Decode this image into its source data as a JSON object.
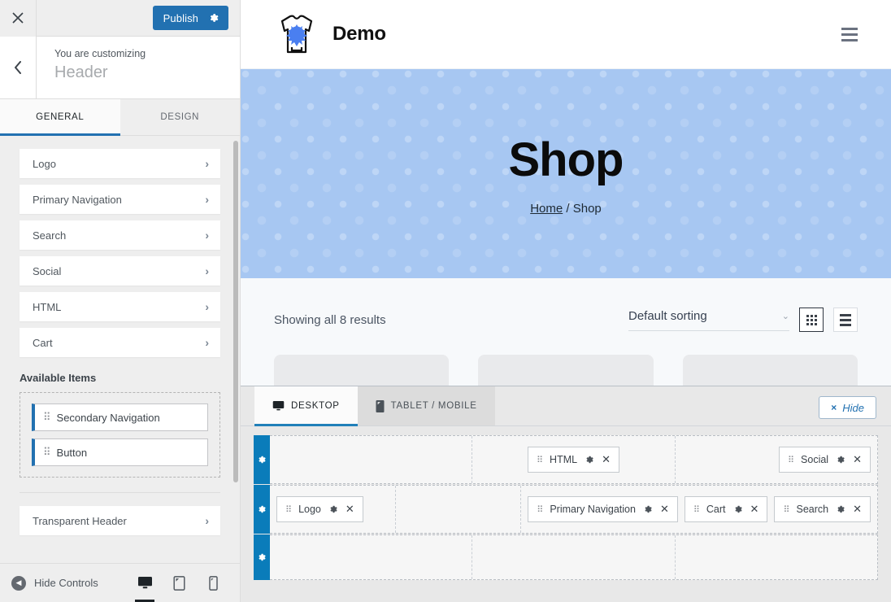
{
  "customizer": {
    "close_label": "×",
    "close_icon": "close-icon",
    "publish_label": "Publish",
    "publish_gear_icon": "gear-icon",
    "back_icon": "chevron-left-icon",
    "customizing_label": "You are customizing",
    "panel_title": "Header",
    "accent_color": "#2271b1",
    "tabs": [
      {
        "label": "GENERAL",
        "active": true
      },
      {
        "label": "DESIGN",
        "active": false
      }
    ],
    "sections": [
      {
        "label": "Logo"
      },
      {
        "label": "Primary Navigation"
      },
      {
        "label": "Search"
      },
      {
        "label": "Social"
      },
      {
        "label": "HTML"
      },
      {
        "label": "Cart"
      }
    ],
    "available_items_title": "Available Items",
    "available_items": [
      {
        "label": "Secondary Navigation"
      },
      {
        "label": "Button"
      }
    ],
    "extra_sections": [
      {
        "label": "Transparent Header"
      }
    ],
    "footer": {
      "hide_controls_label": "Hide Controls",
      "hide_controls_icon": "collapse-arrow-icon",
      "devices": [
        {
          "name": "desktop",
          "icon": "desktop-icon",
          "active": true
        },
        {
          "name": "tablet",
          "icon": "tablet-icon",
          "active": false
        },
        {
          "name": "mobile",
          "icon": "mobile-icon",
          "active": false
        }
      ]
    }
  },
  "preview": {
    "site": {
      "logo_icon": "tshirt-splatter-logo",
      "brand_name": "Demo",
      "menu_icon": "hamburger-icon"
    },
    "hero": {
      "title": "Shop",
      "breadcrumb_home": "Home",
      "breadcrumb_separator": " / ",
      "breadcrumb_current": "Shop",
      "background_color": "#a7c7f2"
    },
    "shop": {
      "result_count": "Showing all 8 results",
      "sorting_value": "Default sorting",
      "sorting_caret_icon": "chevron-down-icon",
      "grid_view_icon": "grid-view-icon",
      "list_view_icon": "list-view-icon",
      "grid_active": true
    }
  },
  "builder": {
    "tabs": [
      {
        "label": "DESKTOP",
        "icon": "desktop-icon",
        "active": true
      },
      {
        "label": "TABLET / MOBILE",
        "icon": "mobile-icon",
        "active": false
      }
    ],
    "hide_label": "Hide",
    "hide_x": "×",
    "rows": [
      {
        "name": "above-header-row",
        "gear_icon": "gear-icon",
        "columns": [
          {
            "align": "start",
            "items": []
          },
          {
            "align": "center",
            "items": [
              {
                "label": "HTML"
              }
            ]
          },
          {
            "align": "end",
            "items": [
              {
                "label": "Social"
              }
            ]
          }
        ]
      },
      {
        "name": "primary-header-row",
        "gear_icon": "gear-icon",
        "columns": [
          {
            "align": "start",
            "items": [
              {
                "label": "Logo"
              }
            ]
          },
          {
            "align": "center",
            "items": []
          },
          {
            "align": "end",
            "items": [
              {
                "label": "Primary Navigation"
              },
              {
                "label": "Cart"
              },
              {
                "label": "Search"
              }
            ]
          }
        ]
      },
      {
        "name": "below-header-row",
        "gear_icon": "gear-icon",
        "columns": [
          {
            "align": "start",
            "items": []
          },
          {
            "align": "center",
            "items": []
          },
          {
            "align": "end",
            "items": []
          }
        ]
      }
    ]
  }
}
